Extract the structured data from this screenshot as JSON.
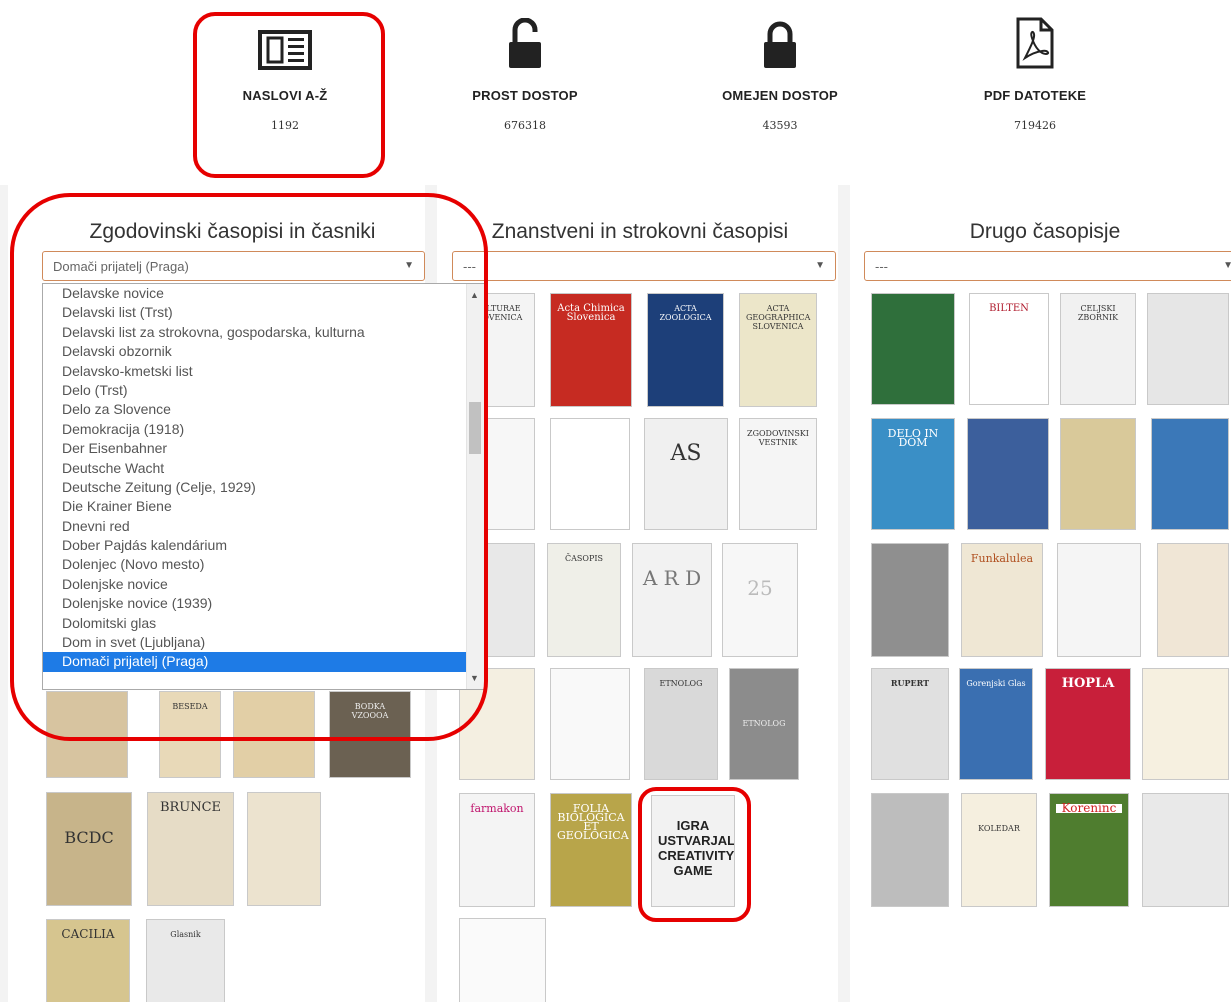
{
  "stats": [
    {
      "icon": "newspaper-icon",
      "label": "NASLOVI A-Ž",
      "count": "1192"
    },
    {
      "icon": "unlock-icon",
      "label": "PROST DOSTOP",
      "count": "676318"
    },
    {
      "icon": "lock-icon",
      "label": "OMEJEN DOSTOP",
      "count": "43593"
    },
    {
      "icon": "pdf-file-icon",
      "label": "PDF DATOTEKE",
      "count": "719426"
    }
  ],
  "columns": [
    {
      "title": "Zgodovinski časopisi in časniki",
      "selected": "Domači prijatelj (Praga)"
    },
    {
      "title": "Znanstveni in strokovni časopisi",
      "selected": "---"
    },
    {
      "title": "Drugo časopisje",
      "selected": "---"
    }
  ],
  "dropdown": {
    "options": [
      "Delavske novice",
      "Delavski list (Trst)",
      "Delavski list za strokovna, gospodarska, kulturna",
      "Delavski obzornik",
      "Delavsko-kmetski list",
      "Delo (Trst)",
      "Delo za Slovence",
      "Demokracija (1918)",
      "Der Eisenbahner",
      "Deutsche Wacht",
      "Deutsche Zeitung (Celje, 1929)",
      "Die Krainer Biene",
      "Dnevni red",
      "Dober Pajdás kalendárium",
      "Dolenjec (Novo mesto)",
      "Dolenjske novice",
      "Dolenjske novice (1939)",
      "Dolomitski glas",
      "Dom in svet (Ljubljana)",
      "Domači prijatelj (Praga)"
    ],
    "selected_index": 19
  },
  "covers": {
    "col1": [
      {
        "title": "BESEDA",
        "bg": "#e8d9b8"
      },
      {
        "title": "",
        "bg": "#e2cfa6"
      },
      {
        "title": "BODKA VZOOOA",
        "bg": "#6b6152"
      },
      {
        "title": "",
        "bg": "#d7c4a0"
      },
      {
        "title": "BRUNCE",
        "bg": "#e6dcc6"
      },
      {
        "title": "",
        "bg": "#ece3cf"
      },
      {
        "title": "CACILIA",
        "bg": "#d6c58f"
      },
      {
        "title": "Glasnik",
        "bg": "#e9e9e9"
      }
    ],
    "col2": [
      {
        "title": "CULTURAE SLOVENICA",
        "bg": "#f4f4f4"
      },
      {
        "title": "Acta Chimica Slovenica",
        "bg": "#c62b22"
      },
      {
        "title": "ACTA ZOOLOGICA",
        "bg": "#1d3f79"
      },
      {
        "title": "ACTA GEOGRAPHICA SLOVENICA",
        "bg": "#ece6c9"
      },
      {
        "title": "",
        "bg": "#f7f7f7"
      },
      {
        "title": "",
        "bg": "#ffffff"
      },
      {
        "title": "AS",
        "bg": "#f0f0f0"
      },
      {
        "title": "ZGODOVINSKI VESTNIK",
        "bg": "#f5f5f5"
      },
      {
        "title": "",
        "bg": "#e8e8e8"
      },
      {
        "title": "ČASOPIS",
        "bg": "#efefe8"
      },
      {
        "title": "A R D",
        "bg": "#f2f2f2"
      },
      {
        "title": "25",
        "bg": "#f7f7f7"
      },
      {
        "title": "",
        "bg": "#f4efe1"
      },
      {
        "title": "",
        "bg": "#f9f9f9"
      },
      {
        "title": "ETNOLOG",
        "bg": "#d9d9d9"
      },
      {
        "title": "ETNOLOG",
        "bg": "#8c8c8c"
      },
      {
        "title": "farmakon",
        "bg": "#f4f4f4"
      },
      {
        "title": "FOLIA BIOLOGICA ET GEOLOGICA",
        "bg": "#b8a54a"
      },
      {
        "title": "IGRA USTVARJALNOSTI CREATIVITY GAME",
        "bg": "#f2f2f2"
      },
      {
        "title": "",
        "bg": "#fafafa"
      }
    ],
    "col3": [
      {
        "title": "",
        "bg": "#2f6f3b"
      },
      {
        "title": "BILTEN",
        "bg": "#ffffff"
      },
      {
        "title": "CELJSKI ZBORNIK",
        "bg": "#f1f1f1"
      },
      {
        "title": "",
        "bg": "#e6e6e6"
      },
      {
        "title": "DELO IN DOM",
        "bg": "#3a8fc6"
      },
      {
        "title": "",
        "bg": "#3c5f9c"
      },
      {
        "title": "",
        "bg": "#d9c99a"
      },
      {
        "title": "",
        "bg": "#3b78b8"
      },
      {
        "title": "",
        "bg": "#8f8f8f"
      },
      {
        "title": "Funkalulea",
        "bg": "#efe7d4"
      },
      {
        "title": "",
        "bg": "#f5f5f5"
      },
      {
        "title": "",
        "bg": "#f0e6d6"
      },
      {
        "title": "RUPERT",
        "bg": "#e0e0e0"
      },
      {
        "title": "Gorenjski Glas",
        "bg": "#3a6fb1"
      },
      {
        "title": "HOPLA",
        "bg": "#c81f3a"
      },
      {
        "title": "",
        "bg": "#f6f0e0"
      },
      {
        "title": "",
        "bg": "#bdbdbd"
      },
      {
        "title": "KOLEDAR",
        "bg": "#f5efdf"
      },
      {
        "title": "Koreninc",
        "bg": "#4f7d2f"
      },
      {
        "title": "",
        "bg": "#e9e9e9"
      }
    ]
  }
}
